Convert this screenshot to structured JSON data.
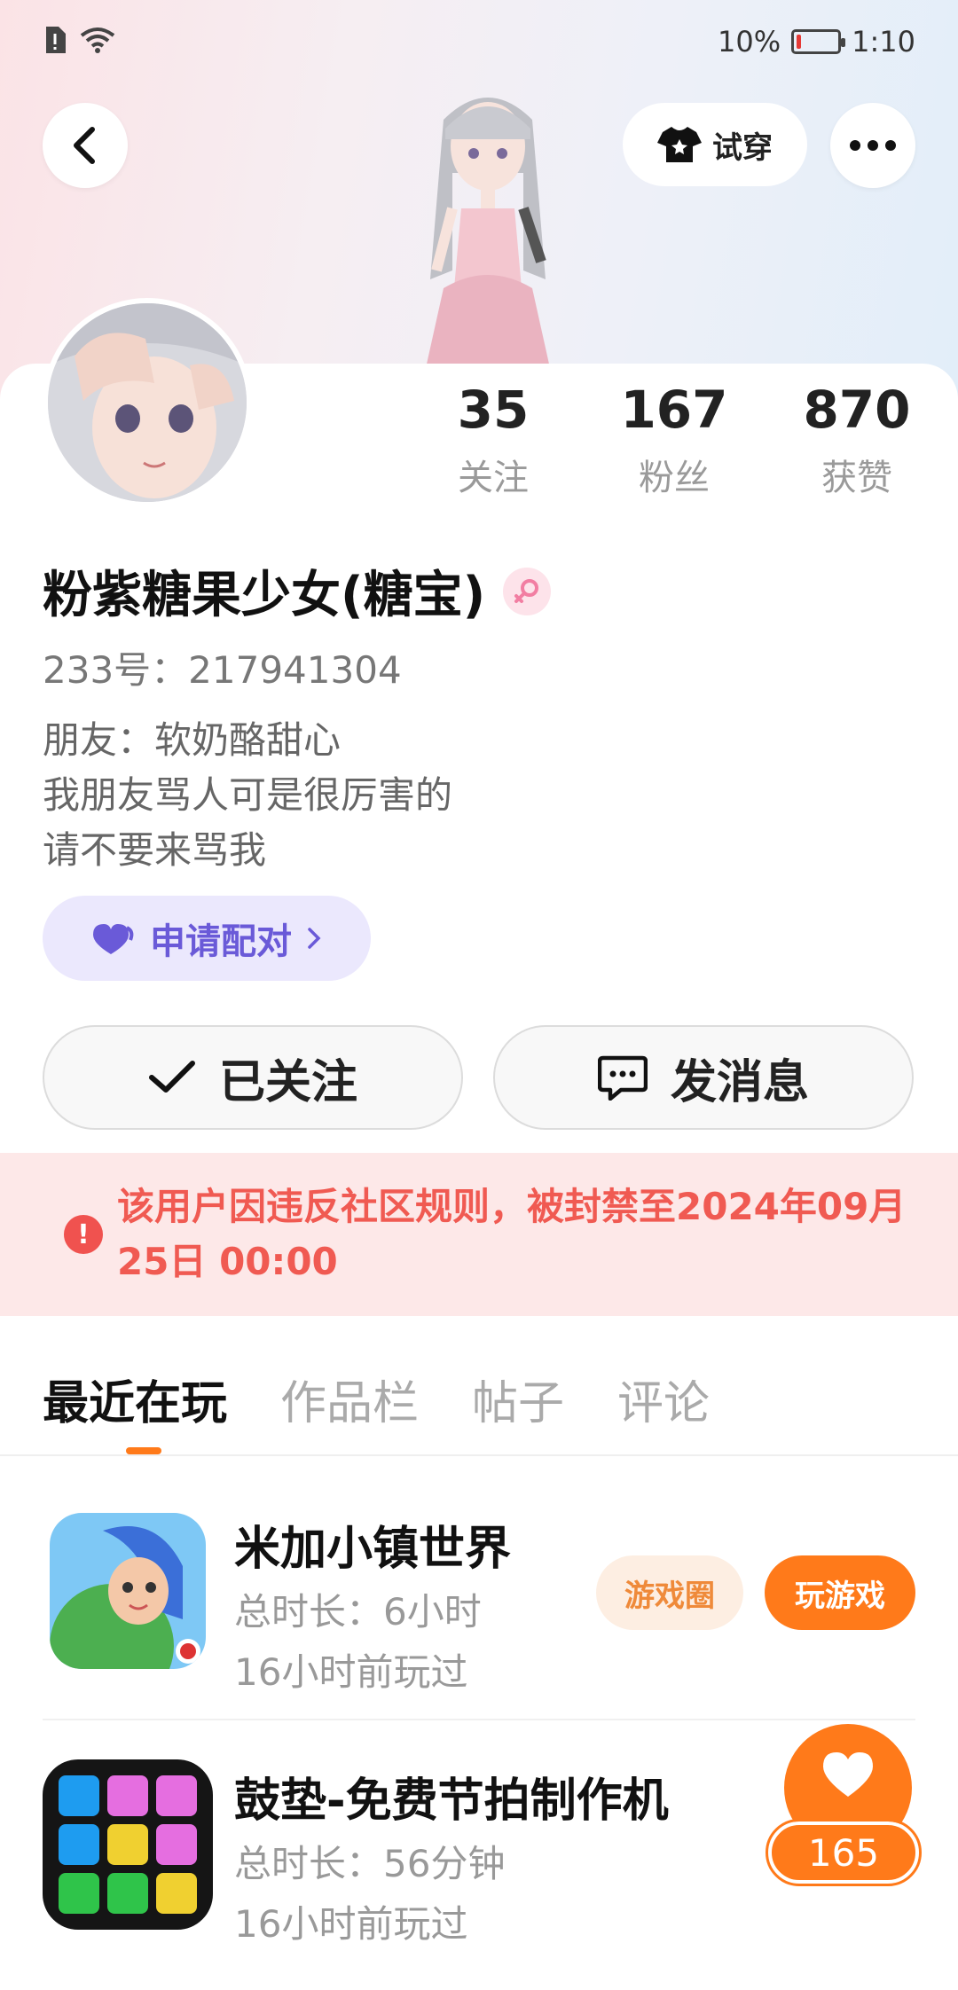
{
  "status_bar": {
    "battery": "10%",
    "battery_level": 0.1,
    "time": "1:10"
  },
  "header": {
    "try_on_label": "试穿"
  },
  "profile": {
    "stats": [
      {
        "value": "35",
        "label": "关注"
      },
      {
        "value": "167",
        "label": "粉丝"
      },
      {
        "value": "870",
        "label": "获赞"
      }
    ],
    "name": "粉紫糖果少女(糖宝)",
    "gender": "female",
    "uid_text": "233号：217941304",
    "bio_lines": [
      "朋友：软奶酪甜心",
      "我朋友骂人可是很厉害的",
      "请不要来骂我"
    ],
    "pair_label": "申请配对"
  },
  "actions": {
    "follow_label": "已关注",
    "message_label": "发消息"
  },
  "ban_notice": {
    "text": "该用户因违反社区规则，被封禁至2024年09月25日 00:00"
  },
  "tabs": [
    {
      "label": "最近在玩",
      "active": true
    },
    {
      "label": "作品栏",
      "active": false
    },
    {
      "label": "帖子",
      "active": false
    },
    {
      "label": "评论",
      "active": false
    }
  ],
  "games": [
    {
      "name": "米加小镇世界",
      "duration": "总时长：6小时",
      "last_played": "16小时前玩过",
      "circle_label": "游戏圈",
      "play_label": "玩游戏"
    },
    {
      "name": "鼓垫-免费节拍制作机",
      "duration": "总时长：56分钟",
      "last_played": "16小时前玩过"
    }
  ],
  "like_fab": {
    "count": "165"
  },
  "colors": {
    "accent": "#ff7a1a",
    "ban_text": "#f05a52",
    "pair": "#6a5ad8"
  }
}
